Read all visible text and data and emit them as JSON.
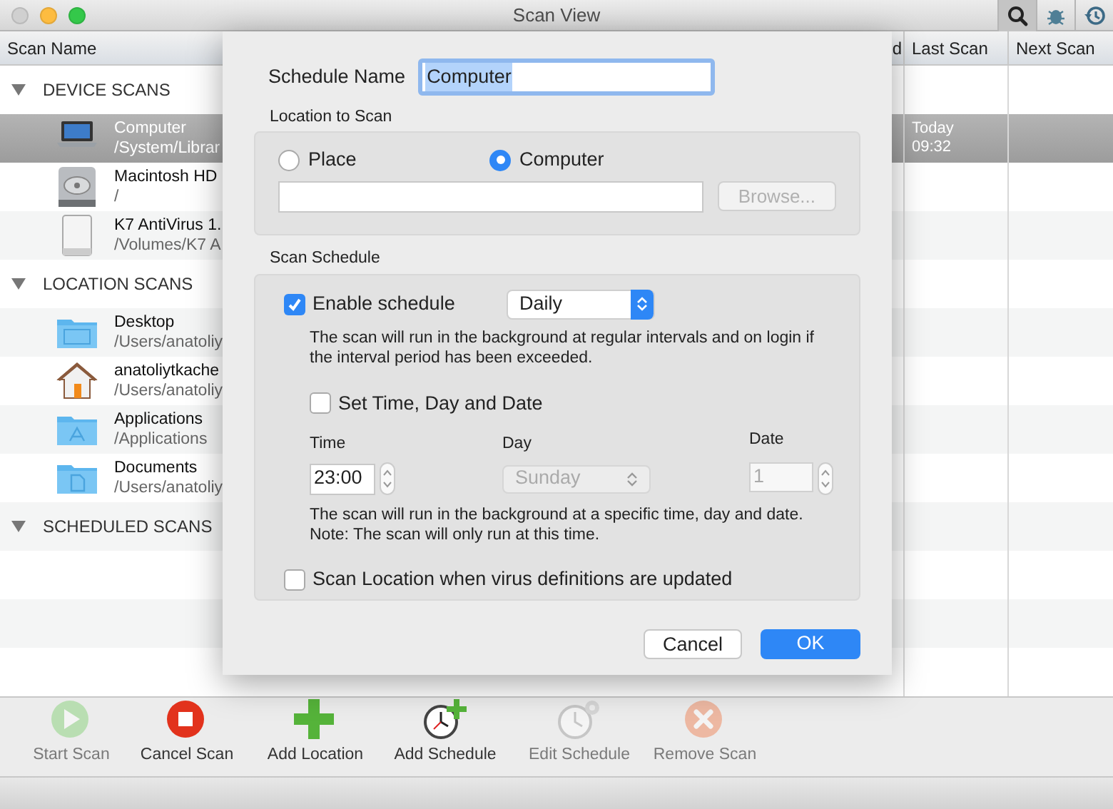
{
  "window": {
    "title": "Scan View",
    "traffic_lights": [
      {
        "kind": "close",
        "disabled": true
      },
      {
        "kind": "minimize",
        "disabled": false
      },
      {
        "kind": "zoom",
        "disabled": false
      }
    ]
  },
  "title_tools": [
    {
      "kind": "search",
      "selected": true
    },
    {
      "kind": "bug",
      "selected": false
    },
    {
      "kind": "history",
      "selected": false
    }
  ],
  "table": {
    "columns": [
      {
        "label": "Scan Name"
      },
      {
        "label": "d"
      },
      {
        "label": "Last Scan"
      },
      {
        "label": "Next Scan"
      }
    ],
    "sections": [
      {
        "label": "DEVICE SCANS",
        "expanded": true,
        "rows": [
          {
            "kind": "laptop",
            "name": "Computer",
            "path": "/System/Librar",
            "last_scan": [
              "Today",
              "09:32"
            ],
            "selected": true
          },
          {
            "kind": "disk",
            "name": "Macintosh HD",
            "path": "/",
            "selected": false
          },
          {
            "kind": "volume",
            "name": "K7 AntiVirus 1.",
            "path": "/Volumes/K7 A",
            "selected": false
          }
        ]
      },
      {
        "label": "LOCATION SCANS",
        "expanded": true,
        "rows": [
          {
            "kind": "folder",
            "name": "Desktop",
            "path": "/Users/anatoliy",
            "selected": false
          },
          {
            "kind": "home",
            "name": "anatoliytkache",
            "path": "/Users/anatoliy",
            "selected": false
          },
          {
            "kind": "apps",
            "name": "Applications",
            "path": "/Applications",
            "selected": false
          },
          {
            "kind": "docs",
            "name": "Documents",
            "path": "/Users/anatoliy",
            "selected": false
          }
        ]
      },
      {
        "label": "SCHEDULED SCANS",
        "expanded": true
      }
    ]
  },
  "dialog": {
    "name_label": "Schedule Name",
    "name_value": "Computer",
    "location_label": "Location to Scan",
    "location_options": [
      {
        "label": "Place",
        "selected": false
      },
      {
        "label": "Computer",
        "selected": true
      }
    ],
    "browse_button": {
      "label": "Browse...",
      "disabled": true
    },
    "schedule_label": "Scan Schedule",
    "enable": {
      "label": "Enable schedule",
      "checked": true
    },
    "frequency": "Daily",
    "enable_note": "The scan will run in the background at regular intervals and on login if the interval period has been exceeded.",
    "set_time": {
      "label": "Set Time, Day and Date",
      "checked": false
    },
    "time_label": "Time",
    "day_label": "Day",
    "date_label": "Date",
    "time_value": "23:00",
    "day_value": "Sunday",
    "date_value": "1",
    "day_disabled": true,
    "date_disabled": true,
    "time_note": "The scan will run in the background at a specific time, day and date.\nNote: The scan will only run at this time.",
    "on_update": {
      "label": "Scan Location when virus definitions are updated",
      "checked": false
    },
    "buttons": [
      {
        "label": "Cancel",
        "default": false
      },
      {
        "label": "OK",
        "default": true
      }
    ]
  },
  "toolbar": [
    {
      "kind": "start",
      "label": "Start Scan",
      "disabled": true
    },
    {
      "kind": "cancel",
      "label": "Cancel Scan",
      "disabled": false
    },
    {
      "kind": "add_location",
      "label": "Add Location",
      "disabled": false
    },
    {
      "kind": "add_schedule",
      "label": "Add Schedule",
      "disabled": false
    },
    {
      "kind": "edit_schedule",
      "label": "Edit Schedule",
      "disabled": true
    },
    {
      "kind": "remove",
      "label": "Remove Scan",
      "disabled": true
    }
  ]
}
